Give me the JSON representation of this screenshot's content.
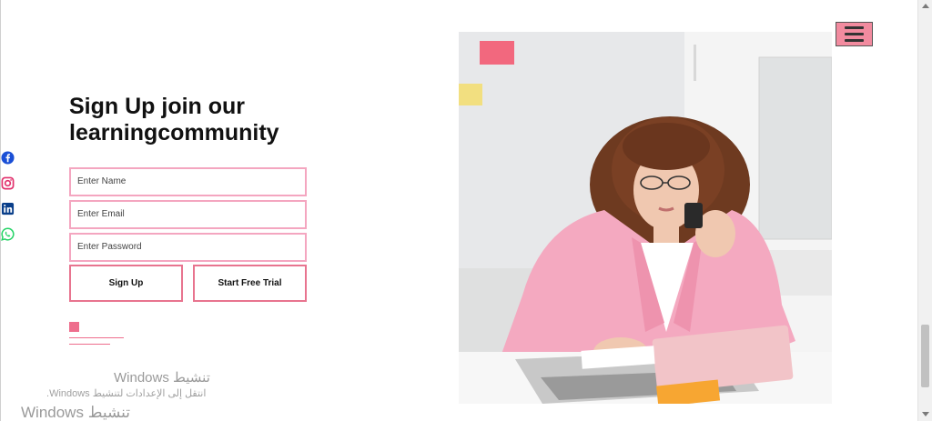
{
  "social": [
    {
      "name": "facebook-icon",
      "color": "#1a4fd6"
    },
    {
      "name": "instagram-icon",
      "color": "#e1306c"
    },
    {
      "name": "linkedin-icon",
      "color": "#0a3f8a"
    },
    {
      "name": "whatsapp-icon",
      "color": "#25d366"
    }
  ],
  "signup": {
    "title": "Sign Up join our learningcommunity",
    "name_placeholder": "Enter Name",
    "email_placeholder": "Enter Email",
    "password_placeholder": "Enter Password",
    "signup_label": "Sign Up",
    "trial_label": "Start Free Trial"
  },
  "menu": {
    "icon": "hamburger-icon",
    "color": "#f28b9f"
  },
  "watermark": {
    "line1": "تنشيط Windows",
    "line2": "انتقل إلى الإعدادات لتنشيط Windows.",
    "line3": "تنشيط Windows"
  },
  "colors": {
    "accent": "#ee6e8d",
    "field_border": "#f4a6c0"
  }
}
